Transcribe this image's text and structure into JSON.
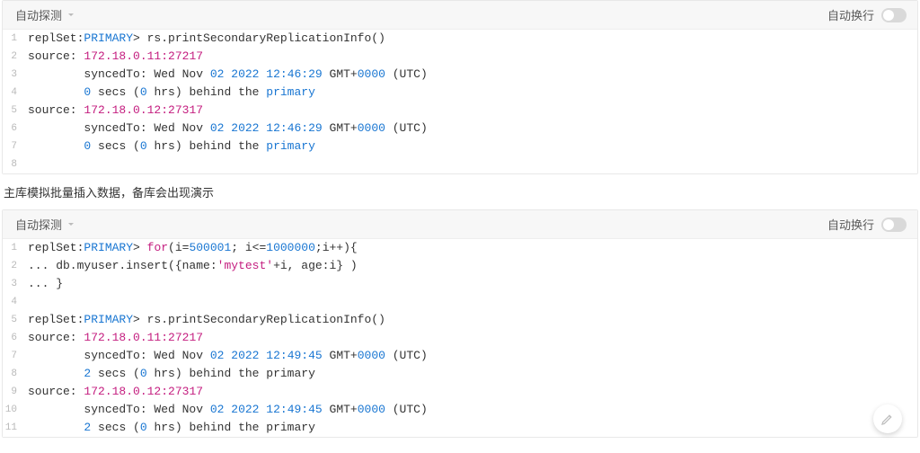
{
  "caption": "主库模拟批量插入数据，备库会出现演示",
  "toolbar": {
    "detect_label": "自动探测",
    "wrap_label": "自动换行"
  },
  "block1": {
    "lines": [
      [
        {
          "t": "replSet:"
        },
        {
          "t": "PRIMARY",
          "c": "kw-pri"
        },
        {
          "t": "> rs.printSecondaryReplicationInfo()"
        }
      ],
      [
        {
          "t": "source: "
        },
        {
          "t": "172.18.0.11:27217",
          "c": "kw-red"
        }
      ],
      [
        {
          "t": "        syncedTo: Wed Nov "
        },
        {
          "t": "02",
          "c": "kw-num"
        },
        {
          "t": " "
        },
        {
          "t": "2022",
          "c": "kw-num"
        },
        {
          "t": " "
        },
        {
          "t": "12:46:29",
          "c": "kw-num"
        },
        {
          "t": " GMT+"
        },
        {
          "t": "0000",
          "c": "kw-num"
        },
        {
          "t": " (UTC)"
        }
      ],
      [
        {
          "t": "        "
        },
        {
          "t": "0",
          "c": "kw-num"
        },
        {
          "t": " secs ("
        },
        {
          "t": "0",
          "c": "kw-num"
        },
        {
          "t": " hrs) behind the "
        },
        {
          "t": "primary",
          "c": "kw-pri"
        }
      ],
      [
        {
          "t": "source: "
        },
        {
          "t": "172.18.0.12:27317",
          "c": "kw-red"
        }
      ],
      [
        {
          "t": "        syncedTo: Wed Nov "
        },
        {
          "t": "02",
          "c": "kw-num"
        },
        {
          "t": " "
        },
        {
          "t": "2022",
          "c": "kw-num"
        },
        {
          "t": " "
        },
        {
          "t": "12:46:29",
          "c": "kw-num"
        },
        {
          "t": " GMT+"
        },
        {
          "t": "0000",
          "c": "kw-num"
        },
        {
          "t": " (UTC)"
        }
      ],
      [
        {
          "t": "        "
        },
        {
          "t": "0",
          "c": "kw-num"
        },
        {
          "t": " secs ("
        },
        {
          "t": "0",
          "c": "kw-num"
        },
        {
          "t": " hrs) behind the "
        },
        {
          "t": "primary",
          "c": "kw-pri"
        }
      ],
      []
    ]
  },
  "block2": {
    "lines": [
      [
        {
          "t": "replSet:"
        },
        {
          "t": "PRIMARY",
          "c": "kw-pri"
        },
        {
          "t": "> "
        },
        {
          "t": "for",
          "c": "kw-red"
        },
        {
          "t": "(i="
        },
        {
          "t": "500001",
          "c": "kw-num"
        },
        {
          "t": "; i<="
        },
        {
          "t": "1000000",
          "c": "kw-num"
        },
        {
          "t": ";i++){"
        }
      ],
      [
        {
          "t": "... db.myuser.insert({name:"
        },
        {
          "t": "'mytest'",
          "c": "kw-str"
        },
        {
          "t": "+i, age:i} )"
        }
      ],
      [
        {
          "t": "... }"
        }
      ],
      [],
      [
        {
          "t": "replSet:"
        },
        {
          "t": "PRIMARY",
          "c": "kw-pri"
        },
        {
          "t": "> rs.printSecondaryReplicationInfo()"
        }
      ],
      [
        {
          "t": "source: "
        },
        {
          "t": "172.18.0.11:27217",
          "c": "kw-red"
        }
      ],
      [
        {
          "t": "        syncedTo: Wed Nov "
        },
        {
          "t": "02",
          "c": "kw-num"
        },
        {
          "t": " "
        },
        {
          "t": "2022",
          "c": "kw-num"
        },
        {
          "t": " "
        },
        {
          "t": "12:49:45",
          "c": "kw-num"
        },
        {
          "t": " GMT+"
        },
        {
          "t": "0000",
          "c": "kw-num"
        },
        {
          "t": " (UTC)"
        }
      ],
      [
        {
          "t": "        "
        },
        {
          "t": "2",
          "c": "kw-num"
        },
        {
          "t": " secs ("
        },
        {
          "t": "0",
          "c": "kw-num"
        },
        {
          "t": " hrs) behind the primary"
        }
      ],
      [
        {
          "t": "source: "
        },
        {
          "t": "172.18.0.12:27317",
          "c": "kw-red"
        }
      ],
      [
        {
          "t": "        syncedTo: Wed Nov "
        },
        {
          "t": "02",
          "c": "kw-num"
        },
        {
          "t": " "
        },
        {
          "t": "2022",
          "c": "kw-num"
        },
        {
          "t": " "
        },
        {
          "t": "12:49:45",
          "c": "kw-num"
        },
        {
          "t": " GMT+"
        },
        {
          "t": "0000",
          "c": "kw-num"
        },
        {
          "t": " (UTC)"
        }
      ],
      [
        {
          "t": "        "
        },
        {
          "t": "2",
          "c": "kw-num"
        },
        {
          "t": " secs ("
        },
        {
          "t": "0",
          "c": "kw-num"
        },
        {
          "t": " hrs) behind the primary"
        }
      ]
    ]
  }
}
